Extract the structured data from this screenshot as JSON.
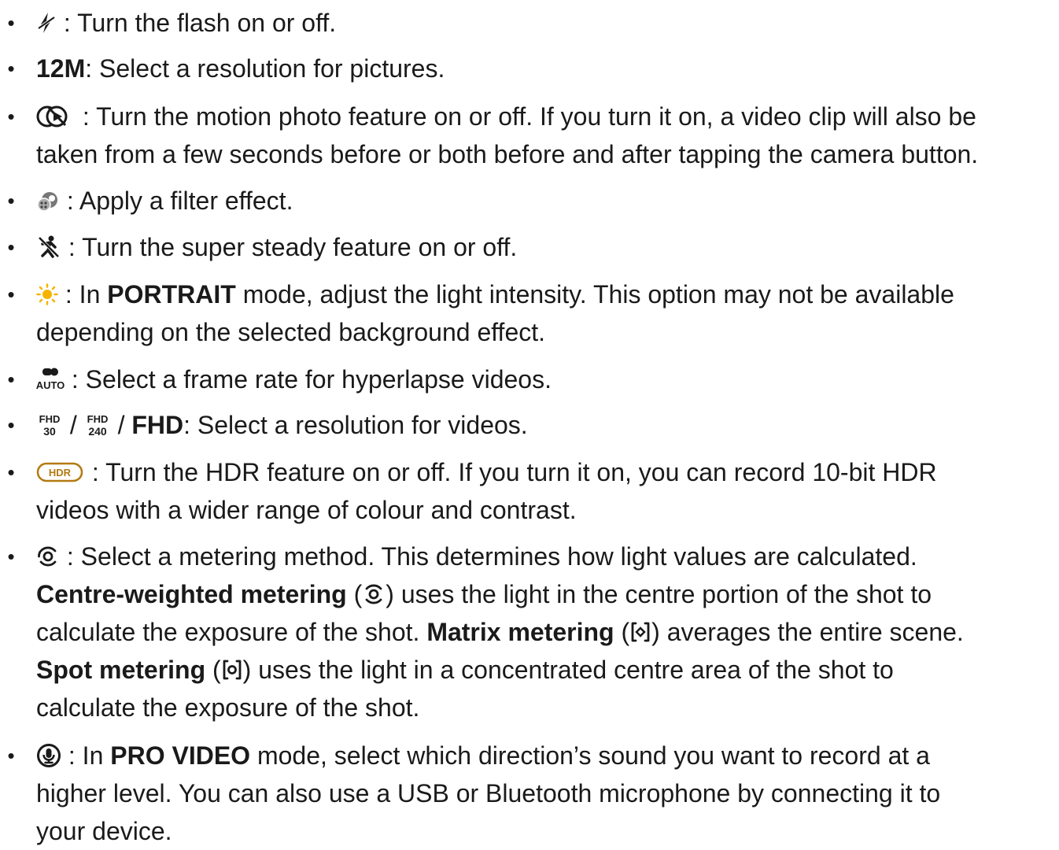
{
  "items": [
    {
      "icon": "flash-off-icon",
      "text": ": Turn the flash on or off."
    },
    {
      "label": "12M",
      "text": ": Select a resolution for pictures."
    },
    {
      "icon": "motion-photo-icon",
      "line1": ": Turn the motion photo feature on or off. If you turn it on, a video clip will also be",
      "line2": "taken from a few seconds before or both before and after tapping the camera button."
    },
    {
      "icon": "filter-icon",
      "text": ": Apply a filter effect."
    },
    {
      "icon": "super-steady-icon",
      "text": ": Turn the super steady feature on or off."
    },
    {
      "icon": "light-intensity-icon",
      "pre": ": In ",
      "bold": "PORTRAIT",
      "line1_rest": " mode, adjust the light intensity. This option may not be available",
      "line2": "depending on the selected background effect."
    },
    {
      "icon": "frame-rate-auto-icon",
      "icon_text": "AUTO",
      "text": ": Select a frame rate for hyperlapse videos."
    },
    {
      "icon_1_top": "FHD",
      "icon_1_bottom": "30",
      "icon_2_top": "FHD",
      "icon_2_bottom": "240",
      "sep": "/",
      "label": "FHD",
      "text": ": Select a resolution for videos."
    },
    {
      "icon": "hdr-icon",
      "icon_text": "HDR",
      "line1": ": Turn the HDR feature on or off. If you turn it on, you can record 10-bit HDR",
      "line2": "videos with a wider range of colour and contrast."
    },
    {
      "icon": "metering-icon",
      "line1": ": Select a metering method. This determines how light values are calculated.",
      "centre_label": "Centre-weighted metering",
      "centre_text_1": " uses the light in the centre portion of the shot to",
      "centre_text_2": "calculate the exposure of the shot. ",
      "matrix_label": "Matrix metering",
      "matrix_text": " averages the entire scene.",
      "spot_label": "Spot metering",
      "spot_text_1": " uses the light in a concentrated centre area of the shot to",
      "spot_text_2": "calculate the exposure of the shot.",
      "open_paren": "(",
      "close_paren": ")"
    },
    {
      "icon": "audio-direction-icon",
      "pre": ": In ",
      "bold": "PRO VIDEO",
      "line1_rest": " mode, select which direction’s sound you want to record at a",
      "line2": "higher level. You can also use a USB or Bluetooth microphone by connecting it to",
      "line3": "your device."
    }
  ],
  "bullet": "•",
  "colors": {
    "text": "#1a1a1a",
    "sun": "#f5b400",
    "hdr": "#b37a12"
  }
}
